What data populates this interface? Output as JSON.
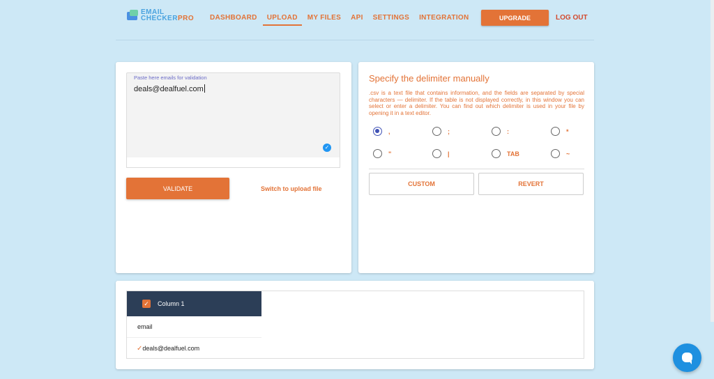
{
  "logo": {
    "line1": "EMAIL",
    "line2a": "CHECKER",
    "line2b": "PRO"
  },
  "nav": [
    {
      "label": "DASHBOARD",
      "active": false
    },
    {
      "label": "UPLOAD",
      "active": true
    },
    {
      "label": "MY FILES",
      "active": false
    },
    {
      "label": "API",
      "active": false
    },
    {
      "label": "SETTINGS",
      "active": false
    },
    {
      "label": "INTEGRATION",
      "active": false
    }
  ],
  "header": {
    "upgrade_label": "UPGRADE",
    "logout_label": "LOG OUT"
  },
  "paste": {
    "label": "Paste here emails for validation",
    "value": "deals@dealfuel.com",
    "validate_label": "VALIDATE",
    "switch_label": "Switch to upload file"
  },
  "delimiter": {
    "title": "Specify the delimiter manually",
    "description": ".csv is a text file that contains information, and the fields are separated by special characters — delimiter. If the table is not displayed correctly, in this window you can select or enter a delimiter. You can find out which delimiter is used in your file by opening it in a text editor.",
    "options": [
      ",",
      ";",
      ":",
      "*",
      "\"",
      "|",
      "TAB",
      "~"
    ],
    "selected": ",",
    "custom_label": "CUSTOM",
    "revert_label": "REVERT"
  },
  "table": {
    "column_title": "Column 1",
    "header_cell": "email",
    "rows": [
      {
        "mark": "✓",
        "value": "deals@dealfuel.com"
      }
    ]
  },
  "colors": {
    "accent": "#e37337",
    "header_dark": "#2c3e57",
    "background": "#cde8f6",
    "chat": "#1e90e0"
  }
}
